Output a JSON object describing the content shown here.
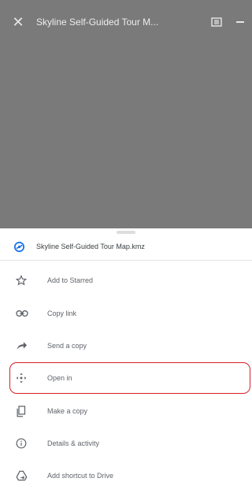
{
  "header": {
    "title": "Skyline Self-Guided Tour M...",
    "close_icon": "close-icon",
    "details_icon": "details-icon",
    "more_icon": "more-icon"
  },
  "sheet": {
    "file_icon": "file-icon",
    "file_name": "Skyline Self-Guided Tour Map.kmz",
    "items": [
      {
        "icon": "star-icon",
        "label": "Add to Starred"
      },
      {
        "icon": "link-icon",
        "label": "Copy link"
      },
      {
        "icon": "share-icon",
        "label": "Send a copy"
      },
      {
        "icon": "open-in-icon",
        "label": "Open in"
      },
      {
        "icon": "copy-icon",
        "label": "Make a copy"
      },
      {
        "icon": "info-icon",
        "label": "Details & activity"
      },
      {
        "icon": "drive-shortcut-icon",
        "label": "Add shortcut to Drive"
      }
    ]
  },
  "colors": {
    "backdrop": "#7a7a7a",
    "highlight": "#d61f26",
    "file_icon": "#1a73e8"
  }
}
